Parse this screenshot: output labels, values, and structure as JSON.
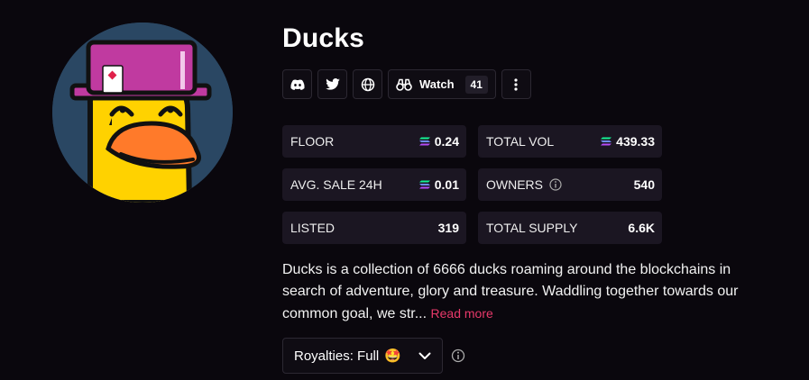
{
  "collection": {
    "name": "Ducks",
    "avatar_icon": "duck-avatar-image"
  },
  "actions": {
    "discord_icon": "discord-icon",
    "twitter_icon": "twitter-icon",
    "website_icon": "globe-icon",
    "watch_label": "Watch",
    "watch_icon": "binoculars-icon",
    "watch_count": "41",
    "more_icon": "more-vertical-icon"
  },
  "stats": {
    "floor_label": "FLOOR",
    "floor_value": "0.24",
    "total_vol_label": "TOTAL VOL",
    "total_vol_value": "439.33",
    "avg_sale_label": "AVG. SALE 24H",
    "avg_sale_value": "0.01",
    "owners_label": "OWNERS",
    "owners_value": "540",
    "listed_label": "LISTED",
    "listed_value": "319",
    "total_supply_label": "TOTAL SUPPLY",
    "total_supply_value": "6.6K",
    "currency_icon": "solana-icon"
  },
  "description": {
    "text": "Ducks is a collection of 6666 ducks roaming around the blockchains in search of adventure, glory and treasure. Waddling together towards our common goal, we str...",
    "read_more": "Read more"
  },
  "royalties": {
    "label": "Royalties: Full",
    "emoji": "🤩"
  },
  "colors": {
    "background": "#0a070d",
    "card": "#1b1622",
    "accent": "#e8396a"
  }
}
